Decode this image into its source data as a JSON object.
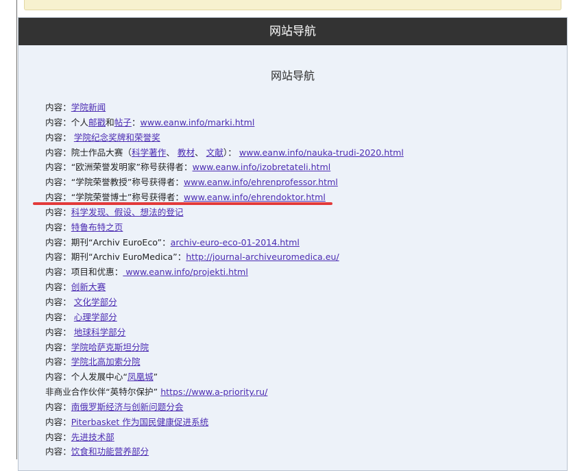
{
  "header": {
    "title": "网站导航"
  },
  "subtitle": "网站导航",
  "items": [
    [
      {
        "t": "内容："
      },
      {
        "t": "学院新闻",
        "link": true
      }
    ],
    [
      {
        "t": "内容：个人"
      },
      {
        "t": "邮戳",
        "link": true
      },
      {
        "t": "和"
      },
      {
        "t": "帖子",
        "link": true
      },
      {
        "t": "："
      },
      {
        "t": "www.eanw.info/marki.html",
        "link": true
      }
    ],
    [
      {
        "t": "内容： "
      },
      {
        "t": "学院纪念奖牌和荣誉奖",
        "link": true
      }
    ],
    [
      {
        "t": "内容：院士作品大赛（"
      },
      {
        "t": "科学著作",
        "link": true
      },
      {
        "t": "、 "
      },
      {
        "t": "教材",
        "link": true
      },
      {
        "t": "、 "
      },
      {
        "t": "文献",
        "link": true
      },
      {
        "t": "）：  "
      },
      {
        "t": "www.eanw.info/nauka-trudi-2020.html",
        "link": true
      }
    ],
    [
      {
        "t": "内容：“欧洲荣誉发明家”称号获得者："
      },
      {
        "t": "www.eanw.info/izobretateli.html",
        "link": true
      }
    ],
    [
      {
        "t": "内容：“学院荣誉教授”称号获得者："
      },
      {
        "t": "www.eanw.info/ehrenprofessor.html",
        "link": true
      }
    ],
    [
      {
        "t": "内容：“学院荣誉博士”称号获得者："
      },
      {
        "t": "www.eanw.info/ehrendoktor.html",
        "link": true
      }
    ],
    [
      {
        "t": "内容："
      },
      {
        "t": "科学发现、假设、想法的登记",
        "link": true
      }
    ],
    [
      {
        "t": "内容："
      },
      {
        "t": "特鲁布特之页",
        "link": true
      }
    ],
    [
      {
        "t": "内容：期刊“Archiv EuroEco”："
      },
      {
        "t": "archiv-euro-eco-01-2014.html",
        "link": true
      }
    ],
    [
      {
        "t": "内容：期刊“Archiv EuroMedica”："
      },
      {
        "t": "http://journal-archiveuromedica.eu/",
        "link": true
      }
    ],
    [
      {
        "t": "内容：项目和优惠："
      },
      {
        "t": " www.eanw.info/projekti.html",
        "link": true
      }
    ],
    [
      {
        "t": "内容："
      },
      {
        "t": "创新大赛",
        "link": true
      }
    ],
    [
      {
        "t": "内容： "
      },
      {
        "t": "文化学部分",
        "link": true
      }
    ],
    [
      {
        "t": "内容： "
      },
      {
        "t": "心理学部分",
        "link": true
      }
    ],
    [
      {
        "t": "内容： "
      },
      {
        "t": "地球科学部分",
        "link": true
      }
    ],
    [
      {
        "t": "内容："
      },
      {
        "t": "学院哈萨克斯坦分院",
        "link": true
      }
    ],
    [
      {
        "t": "内容："
      },
      {
        "t": "学院北高加索分院",
        "link": true
      }
    ],
    [
      {
        "t": "内容：个人发展中心“"
      },
      {
        "t": "凤凰城",
        "link": true
      },
      {
        "t": "”"
      }
    ],
    [
      {
        "t": "非商业合作伙伴“英特尔保护” "
      },
      {
        "t": "https://www.a-priority.ru/",
        "link": true
      }
    ],
    [
      {
        "t": "内容："
      },
      {
        "t": "南俄罗斯经济与创新问题分会",
        "link": true
      }
    ],
    [
      {
        "t": "内容："
      },
      {
        "t": "Piterbasket 作为国民健康促进系统",
        "link": true
      }
    ],
    [
      {
        "t": "内容："
      },
      {
        "t": "先进技术部",
        "link": true
      }
    ],
    [
      {
        "t": "内容："
      },
      {
        "t": "饮食和功能营养部分",
        "link": true
      }
    ]
  ]
}
